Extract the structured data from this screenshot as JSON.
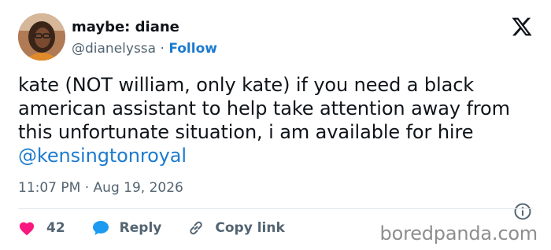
{
  "author": {
    "display_name": "maybe: diane",
    "handle": "@dianelyssa",
    "separator": "·",
    "follow_label": "Follow"
  },
  "tweet": {
    "text_before": "kate (NOT william, only kate) if you need a black american assistant to help take attention away from this unfortunate situation, i am available for hire ",
    "mention": "@kensingtonroyal"
  },
  "meta": {
    "time": "11:07 PM",
    "separator": "·",
    "date": "Aug 19, 2026"
  },
  "actions": {
    "like_count": "42",
    "reply_label": "Reply",
    "copy_label": "Copy link"
  },
  "watermark": "boredpanda.com",
  "colors": {
    "like_heart": "#f91880",
    "reply_bubble": "#1d9bf0",
    "link_blue": "#1d7bcf",
    "secondary_text": "#536471"
  }
}
